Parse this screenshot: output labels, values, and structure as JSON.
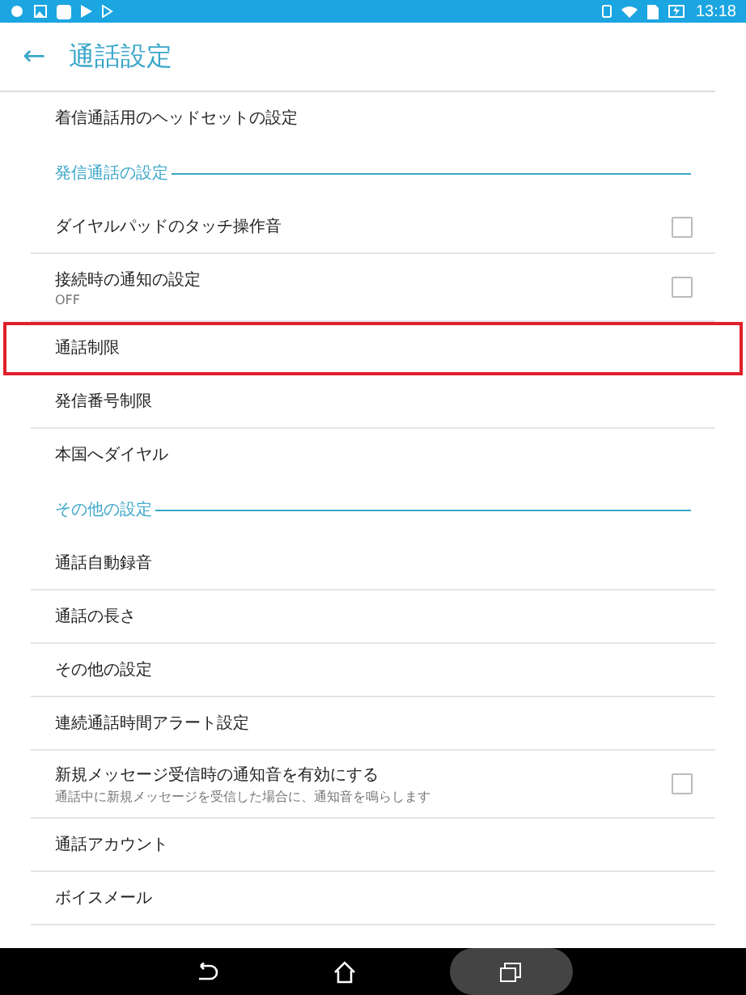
{
  "status_bar": {
    "time": "13:18"
  },
  "header": {
    "back": "←",
    "title": "通話設定"
  },
  "sections": [
    {
      "items": [
        {
          "kind": "plain",
          "label": "着信通話用のヘッドセットの設定",
          "highlighted": false
        }
      ]
    },
    {
      "title": "発信通話の設定",
      "items": [
        {
          "kind": "checkbox",
          "label": "ダイヤルパッドのタッチ操作音",
          "checked": false,
          "highlighted": false
        },
        {
          "kind": "checkbox",
          "label": "接続時の通知の設定",
          "summary": "OFF",
          "checked": false,
          "highlighted": false
        },
        {
          "kind": "plain",
          "label": "通話制限",
          "highlighted": true
        },
        {
          "kind": "plain",
          "label": "発信番号制限",
          "highlighted": false
        },
        {
          "kind": "plain",
          "label": "本国へダイヤル",
          "highlighted": false
        }
      ]
    },
    {
      "title": "その他の設定",
      "items": [
        {
          "kind": "plain",
          "label": "通話自動録音",
          "highlighted": false
        },
        {
          "kind": "plain",
          "label": "通話の長さ",
          "highlighted": false
        },
        {
          "kind": "plain",
          "label": "その他の設定",
          "highlighted": false
        },
        {
          "kind": "plain",
          "label": "連続通話時間アラート設定",
          "highlighted": false
        },
        {
          "kind": "checkbox",
          "label": "新規メッセージ受信時の通知音を有効にする",
          "summary": "通話中に新規メッセージを受信した場合に、通知音を鳴らします",
          "checked": false,
          "highlighted": false
        },
        {
          "kind": "plain",
          "label": "通話アカウント",
          "highlighted": false
        },
        {
          "kind": "plain",
          "label": "ボイスメール",
          "highlighted": false
        }
      ]
    }
  ]
}
